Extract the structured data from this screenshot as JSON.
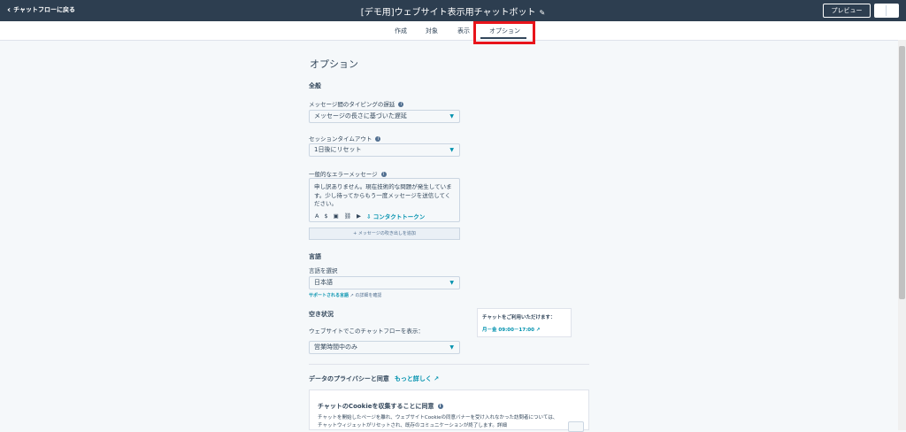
{
  "header": {
    "back_label": "チャットフローに戻る",
    "title": "[デモ用]ウェブサイト表示用チャットボット",
    "preview_label": "プレビュー"
  },
  "tabs": [
    {
      "label": "作成"
    },
    {
      "label": "対象"
    },
    {
      "label": "表示"
    },
    {
      "label": "オプション",
      "active": true
    }
  ],
  "page": {
    "heading": "オプション",
    "general": {
      "section_title": "全般",
      "typing_delay": {
        "label": "メッセージ間のタイピングの遅延",
        "value": "メッセージの長さに基づいた遅延"
      },
      "session_timeout": {
        "label": "セッションタイムアウト",
        "value": "1日後にリセット"
      },
      "error_message": {
        "label": "一般的なエラーメッセージ",
        "value": "申し訳ありません。現在技術的な問題が発生しています。少し待ってからもう一度メッセージを送信してください。",
        "token_label": "コンタクトトークン"
      },
      "add_message_label": "+ メッセージの吹き出しを追加"
    },
    "language": {
      "section_title": "言語",
      "label": "言語を選択",
      "value": "日本語",
      "supported_link": "サポートされる言語",
      "supported_suffix": "の詳細を確認"
    },
    "availability": {
      "section_title": "空き状況",
      "label": "ウェブサイトでこのチャットフローを表示：",
      "value": "営業時間中のみ",
      "hours_title": "チャットをご利用いただけます：",
      "hours_value": "月－金 09:00－17:00"
    },
    "privacy": {
      "title": "データのプライバシーと同意",
      "more_link": "もっと詳しく",
      "cookie_title": "チャットのCookieを収集することに同意",
      "cookie_desc": "チャットを開始したページを離れ、ウェブサイトCookieの同意バナーを受け入れなかった訪問者については、チャットウィジェットがリセットされ、既存のコミュニケーションが終了します。詳細"
    }
  },
  "colors": {
    "topbar": "#2d3e50",
    "accent": "#0091ae",
    "highlight": "#e8141b"
  }
}
